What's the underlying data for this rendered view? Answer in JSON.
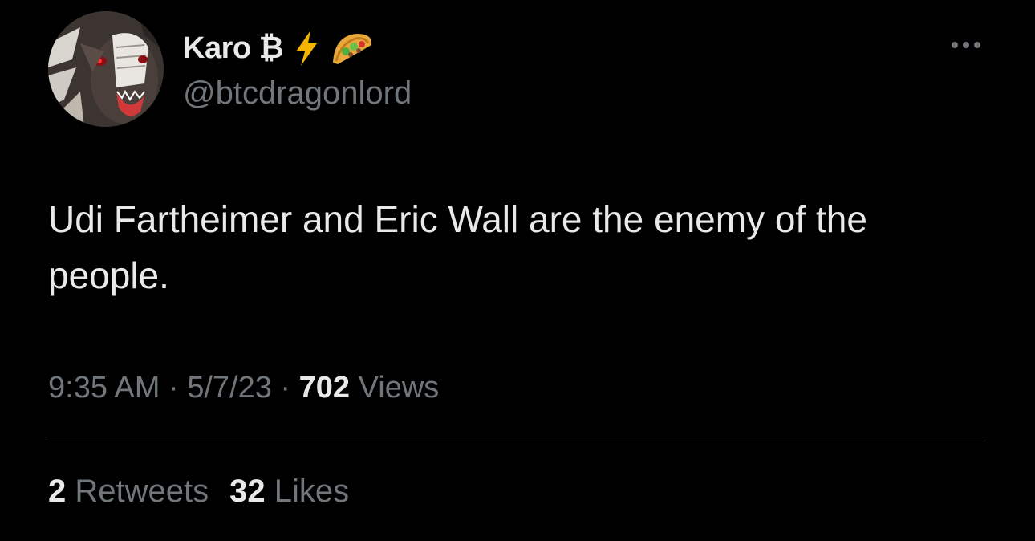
{
  "author": {
    "display_name": "Karo ₿",
    "handle": "@btcdragonlord",
    "name_emojis": [
      "lightning-icon",
      "taco-icon"
    ]
  },
  "tweet": {
    "text": "Udi Fartheimer and Eric Wall are the enemy of the people.",
    "time": "9:35 AM",
    "separator": "·",
    "date": "5/7/23",
    "views_count": "702",
    "views_label": "Views"
  },
  "stats": {
    "retweets_count": "2",
    "retweets_label": "Retweets",
    "likes_count": "32",
    "likes_label": "Likes"
  },
  "colors": {
    "background": "#000000",
    "primary_text": "#e7e9ea",
    "secondary_text": "#71767b",
    "divider": "#2f3336",
    "lightning": "#f4b400"
  }
}
